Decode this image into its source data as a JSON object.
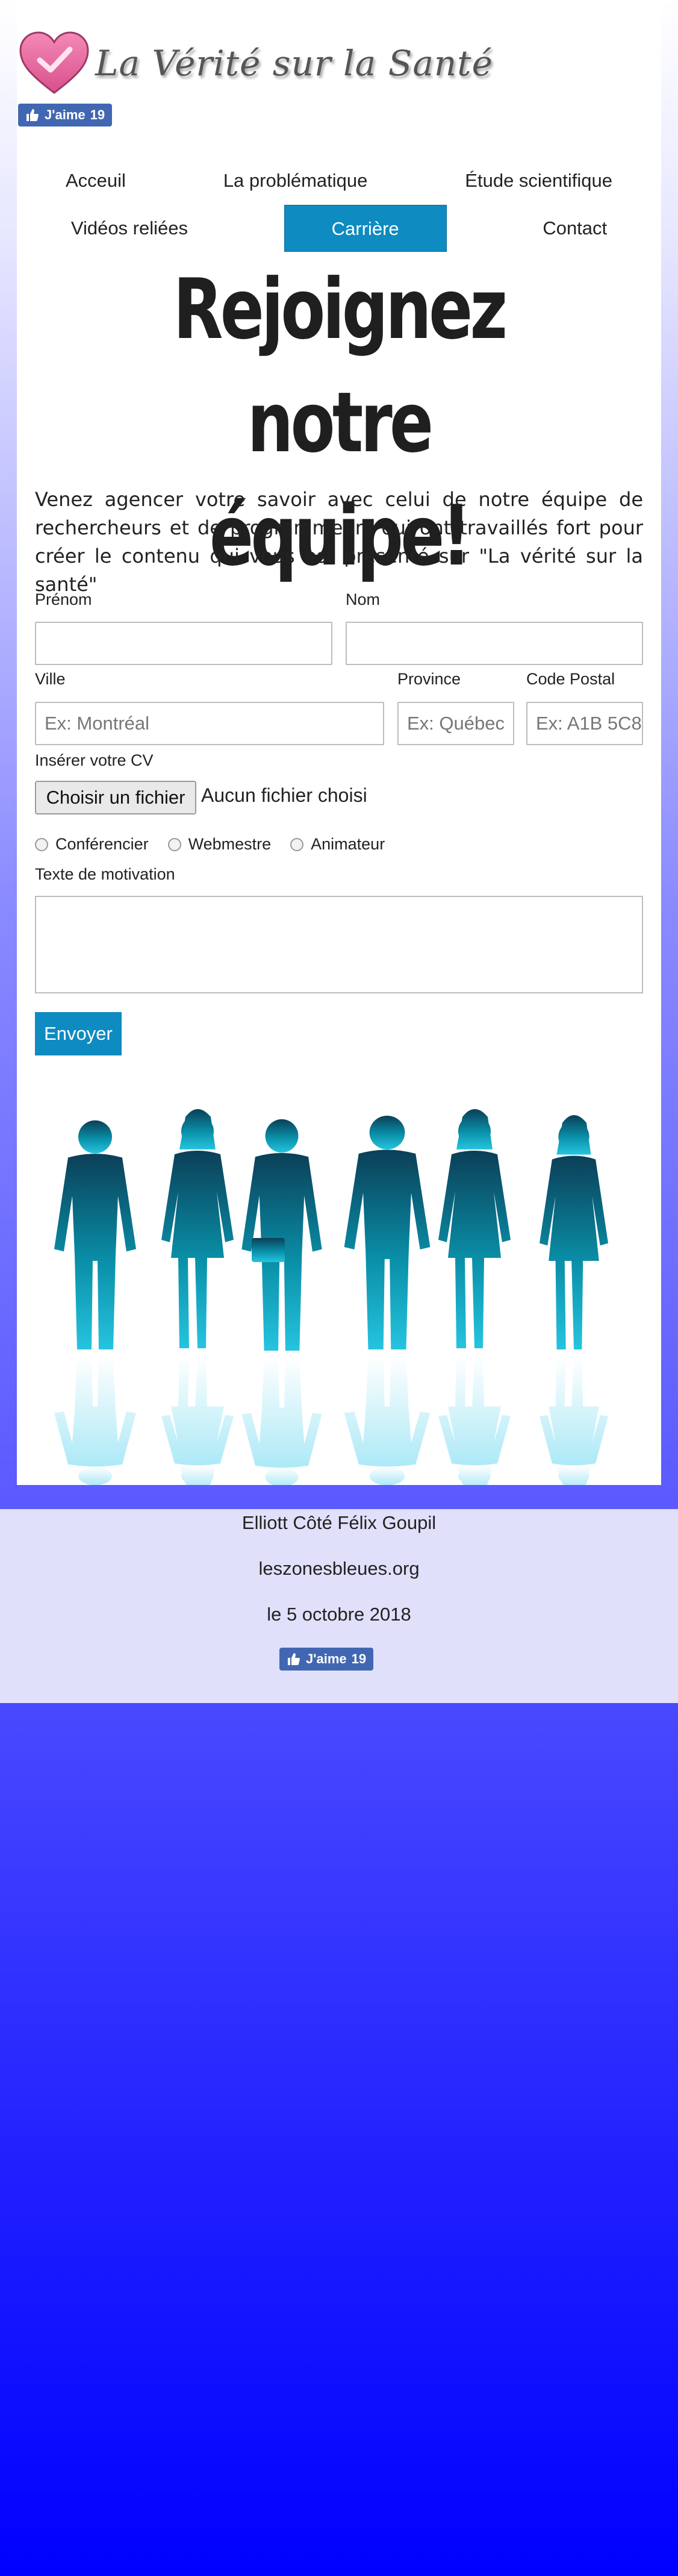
{
  "header": {
    "site_title": "La Vérité sur la Santé",
    "logo_icon": "heart-check-icon",
    "fb_like_label": "J'aime",
    "fb_like_count": "19"
  },
  "nav": {
    "items": [
      {
        "label": "Acceuil"
      },
      {
        "label": "La problématique"
      },
      {
        "label": "Étude scientifique"
      },
      {
        "label": "Vidéos reliées"
      },
      {
        "label": "Carrière",
        "active": true
      },
      {
        "label": "Contact"
      }
    ],
    "active_color": "#0e8bc0"
  },
  "main": {
    "title_line1": "Rejoignez notre",
    "title_line2": "équipe!",
    "intro": "Venez agencer votre savoir avec celui de notre équipe de rechercheurs et de programmeurs qui ont travaillés fort pour créer le contenu qui vous est présenté sur \"La vérité sur la santé\""
  },
  "form": {
    "prenom_label": "Prénom",
    "nom_label": "Nom",
    "ville_label": "Ville",
    "ville_placeholder": "Ex: Montréal",
    "province_label": "Province",
    "province_placeholder": "Ex: Québec",
    "postal_label": "Code Postal",
    "postal_placeholder": "Ex: A1B 5C8",
    "cv_label": "Insérer votre CV",
    "file_button": "Choisir un fichier",
    "file_status": "Aucun fichier choisi",
    "radios": [
      "Conférencier",
      "Webmestre",
      "Animateur"
    ],
    "motivation_label": "Texte de motivation",
    "submit_label": "Envoyer"
  },
  "footer": {
    "authors": "Elliott Côté Félix Goupil",
    "site": "leszonesbleues.org",
    "date": "le 5 octobre 2018",
    "fb_like_label": "J'aime",
    "fb_like_count": "19"
  },
  "colors": {
    "accent": "#0e8bc0",
    "fb_blue": "#4267b2",
    "footer_bg": "#e0e0fb",
    "page_gradient_end": "#0000ff"
  }
}
